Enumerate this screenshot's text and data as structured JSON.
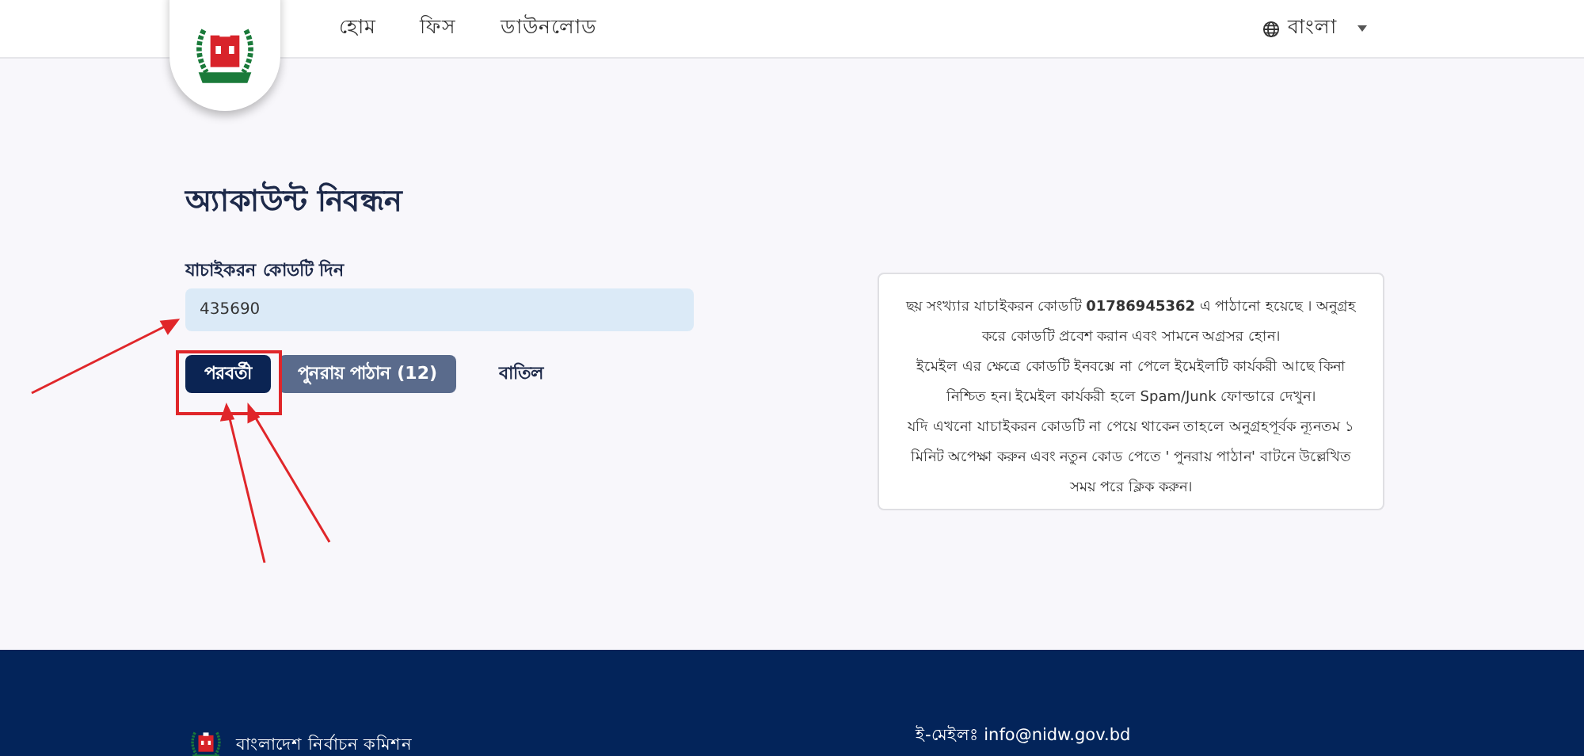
{
  "header": {
    "nav": [
      "হোম",
      "ফিস",
      "ডাউনলোড"
    ],
    "language": "বাংলা"
  },
  "form": {
    "title": "অ্যাকাউন্ট নিবন্ধন",
    "label": "যাচাইকরন কোডটি দিন",
    "value": "435690",
    "buttons": [
      {
        "label": "পরবর্তী",
        "kind": "primary"
      },
      {
        "label": "পুনরায় পাঠান (12)",
        "kind": "secondary"
      },
      {
        "label": "বাতিল",
        "kind": "link"
      }
    ]
  },
  "info": [
    "ছয় সংখ্যার যাচাইকরন কোডটি **01786945362** এ পাঠানো হয়েছে । অনুগ্রহ করে কোডটি প্রবেশ করান এবং সামনে অগ্রসর হোন।",
    "ইমেইল এর ক্ষেত্রে কোডটি ইনবক্সে না পেলে ইমেইলটি কার্যকরী আছে কিনা নিশ্চিত হন। ইমেইল কার্যকরী হলে Spam/Junk ফোল্ডারে দেখুন।",
    "যদি এখনো যাচাইকরন কোডটি না পেয়ে থাকেন তাহলে অনুগ্রহপূর্বক ন্যূনতম ১ মিনিট অপেক্ষা করুন এবং নতুন কোড পেতে ' পুনরায় পাঠান' বাটনে উল্লেখিত সময় পরে ক্লিক করুন।"
  ],
  "footer": {
    "organization": "বাংলাদেশ নির্বাচন কমিশন",
    "email": "ই-মেইলঃ info@nidw.gov.bd"
  }
}
